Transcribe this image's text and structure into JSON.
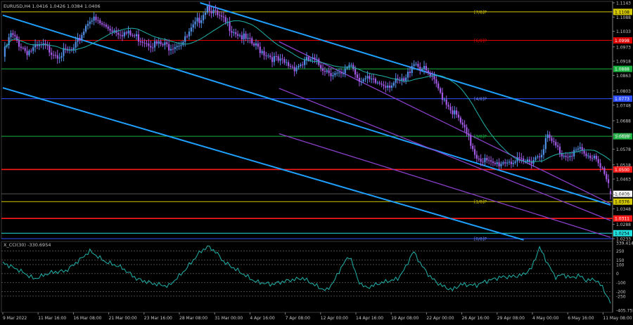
{
  "chart_data": [
    {
      "type": "candlestick",
      "title": "EURUSD,H4  1.0416 1.0426 1.0384 1.0406",
      "symbol": "EURUSD",
      "timeframe": "H4",
      "ohlc": {
        "open": 1.0416,
        "high": 1.0426,
        "low": 1.0384,
        "close": 1.0406
      },
      "ylim": [
        1.0233,
        1.1143
      ],
      "x_tick_labels": [
        "9 Mar 2022",
        "11 Mar 16:00",
        "16 Mar 08:00",
        "21 Mar 00:00",
        "23 Mar 16:00",
        "28 Mar 08:00",
        "31 Mar 00:00",
        "4 Apr 16:00",
        "7 Apr 08:00",
        "12 Apr 00:00",
        "14 Apr 16:00",
        "19 Apr 08:00",
        "22 Apr 00:00",
        "26 Apr 16:00",
        "29 Apr 08:00",
        "4 May 00:00",
        "6 May 16:00",
        "11 May 08:00"
      ],
      "y_tick_labels": [
        "1.1143",
        "1.1088",
        "1.1033",
        "1.0973",
        "1.0918",
        "1.0863",
        "1.0803",
        "1.0748",
        "1.0688",
        "1.0633",
        "1.0578",
        "1.0518",
        "1.0463",
        "1.0403",
        "1.0348",
        "1.0288",
        "1.0233"
      ],
      "close_path": [
        {
          "t": 0,
          "p": 1.0935
        },
        {
          "t": 1,
          "p": 1.102
        },
        {
          "t": 3,
          "p": 1.0955
        },
        {
          "t": 5,
          "p": 1.0975
        },
        {
          "t": 7,
          "p": 1.0945
        },
        {
          "t": 9,
          "p": 1.096
        },
        {
          "t": 11,
          "p": 1.1085
        },
        {
          "t": 13,
          "p": 1.105
        },
        {
          "t": 15,
          "p": 1.103
        },
        {
          "t": 17,
          "p": 1.101
        },
        {
          "t": 19,
          "p": 1.0985
        },
        {
          "t": 21,
          "p": 1.0975
        },
        {
          "t": 23,
          "p": 1.0995
        },
        {
          "t": 25,
          "p": 1.1085
        },
        {
          "t": 26,
          "p": 1.1135
        },
        {
          "t": 27,
          "p": 1.1095
        },
        {
          "t": 29,
          "p": 1.1045
        },
        {
          "t": 31,
          "p": 1.0995
        },
        {
          "t": 33,
          "p": 1.0955
        },
        {
          "t": 35,
          "p": 1.0915
        },
        {
          "t": 37,
          "p": 1.0895
        },
        {
          "t": 39,
          "p": 1.0925
        },
        {
          "t": 41,
          "p": 1.0885
        },
        {
          "t": 43,
          "p": 1.0855
        },
        {
          "t": 44,
          "p": 1.0915
        },
        {
          "t": 45,
          "p": 1.0855
        },
        {
          "t": 47,
          "p": 1.0835
        },
        {
          "t": 49,
          "p": 1.083
        },
        {
          "t": 51,
          "p": 1.084
        },
        {
          "t": 52,
          "p": 1.092
        },
        {
          "t": 54,
          "p": 1.0865
        },
        {
          "t": 56,
          "p": 1.077
        },
        {
          "t": 58,
          "p": 1.068
        },
        {
          "t": 60,
          "p": 1.0555
        },
        {
          "t": 62,
          "p": 1.0515
        },
        {
          "t": 64,
          "p": 1.0535
        },
        {
          "t": 66,
          "p": 1.0525
        },
        {
          "t": 68,
          "p": 1.0555
        },
        {
          "t": 69,
          "p": 1.0625
        },
        {
          "t": 71,
          "p": 1.0555
        },
        {
          "t": 73,
          "p": 1.0575
        },
        {
          "t": 74,
          "p": 1.0545
        },
        {
          "t": 75,
          "p": 1.0555
        },
        {
          "t": 76,
          "p": 1.0505
        },
        {
          "t": 77,
          "p": 1.0406
        }
      ],
      "moving_average_color": "#20b2aa",
      "candle_up_color": "#4f90e6",
      "candle_down_color": "#a259e6",
      "horizontal_levels": [
        {
          "price": 1.1108,
          "label": "[7/8]P",
          "color": "#d4c800",
          "price_label": "1.1108"
        },
        {
          "price": 1.0998,
          "label": "[6/8]P",
          "color": "#e00000",
          "price_label": "1.0998"
        },
        {
          "price": 1.0888,
          "label": "",
          "color": "#1ab040",
          "price_label": "1.0888"
        },
        {
          "price": 1.0773,
          "label": "[4/8]P",
          "color": "#3050ff",
          "price_label": "1.0773"
        },
        {
          "price": 1.0628,
          "label": "[3/8]P",
          "color": "#1ab040",
          "price_label": "1.0628"
        },
        {
          "price": 1.05,
          "label": "",
          "color": "#ff1a1a",
          "price_label": "1.0500"
        },
        {
          "price": 1.0406,
          "label": "",
          "color": "#ffffff",
          "price_label": "1.0406"
        },
        {
          "price": 1.0376,
          "label": "[1/8]P",
          "color": "#d4c800",
          "price_label": "1.0376"
        },
        {
          "price": 1.0311,
          "label": "",
          "color": "#ff1a1a",
          "price_label": "1.0311"
        },
        {
          "price": 1.0254,
          "label": "",
          "color": "#20e0e0",
          "price_label": "1.0254"
        },
        {
          "price": 1.0233,
          "label": "[0/8]P",
          "color": "#3050ff",
          "price_label": ""
        }
      ],
      "trend_channels": [
        {
          "color": "#1fa0ff",
          "t1": 0,
          "p1": 1.1095,
          "t2": 77,
          "p2": 1.0363
        },
        {
          "color": "#1fa0ff",
          "t1": 0,
          "p1": 1.0815,
          "t2": 66,
          "p2": 1.0228
        },
        {
          "color": "#1fa0ff",
          "t1": 25,
          "p1": 1.1143,
          "t2": 77,
          "p2": 1.0658
        },
        {
          "color": "#8a3fc8",
          "t1": 35,
          "p1": 1.0993,
          "t2": 77,
          "p2": 1.0368
        },
        {
          "color": "#8a3fc8",
          "t1": 35,
          "p1": 1.0638,
          "t2": 77,
          "p2": 1.0238
        },
        {
          "color": "#8a3fc8",
          "t1": 35,
          "p1": 1.0813,
          "t2": 77,
          "p2": 1.0303
        }
      ]
    },
    {
      "type": "line",
      "title": "X_CCI(30) -330.6954",
      "indicator": "CCI",
      "period": 30,
      "last_value": -330.6954,
      "line_color": "#20b2aa",
      "ylim": [
        -405.7559,
        339.4148
      ],
      "y_tick_labels": [
        "339.4148",
        "250",
        "150",
        "100",
        "0",
        "-100",
        "-200",
        "-250",
        "-405.7559"
      ],
      "levels": [
        250,
        150,
        100,
        0,
        -100,
        -200,
        -250
      ],
      "values": [
        {
          "t": 0,
          "v": 120
        },
        {
          "t": 2,
          "v": 40
        },
        {
          "t": 4,
          "v": -60
        },
        {
          "t": 6,
          "v": 10
        },
        {
          "t": 8,
          "v": 30
        },
        {
          "t": 10,
          "v": 170
        },
        {
          "t": 11,
          "v": 250
        },
        {
          "t": 13,
          "v": 130
        },
        {
          "t": 15,
          "v": 70
        },
        {
          "t": 17,
          "v": -60
        },
        {
          "t": 19,
          "v": -110
        },
        {
          "t": 21,
          "v": -140
        },
        {
          "t": 23,
          "v": 30
        },
        {
          "t": 25,
          "v": 240
        },
        {
          "t": 26,
          "v": 300
        },
        {
          "t": 27,
          "v": 240
        },
        {
          "t": 28,
          "v": 130
        },
        {
          "t": 30,
          "v": 20
        },
        {
          "t": 32,
          "v": -90
        },
        {
          "t": 34,
          "v": -120
        },
        {
          "t": 36,
          "v": -80
        },
        {
          "t": 38,
          "v": -50
        },
        {
          "t": 40,
          "v": -150
        },
        {
          "t": 41,
          "v": -190
        },
        {
          "t": 42,
          "v": -80
        },
        {
          "t": 43,
          "v": 90
        },
        {
          "t": 44,
          "v": 200
        },
        {
          "t": 45,
          "v": -80
        },
        {
          "t": 46,
          "v": -160
        },
        {
          "t": 48,
          "v": -100
        },
        {
          "t": 50,
          "v": -60
        },
        {
          "t": 51,
          "v": 60
        },
        {
          "t": 52,
          "v": 250
        },
        {
          "t": 53,
          "v": 100
        },
        {
          "t": 54,
          "v": -20
        },
        {
          "t": 55,
          "v": -100
        },
        {
          "t": 56,
          "v": -150
        },
        {
          "t": 57,
          "v": -180
        },
        {
          "t": 58,
          "v": -120
        },
        {
          "t": 60,
          "v": -130
        },
        {
          "t": 61,
          "v": -90
        },
        {
          "t": 63,
          "v": -40
        },
        {
          "t": 65,
          "v": -30
        },
        {
          "t": 66,
          "v": -10
        },
        {
          "t": 67,
          "v": 60
        },
        {
          "t": 68,
          "v": 290
        },
        {
          "t": 69,
          "v": 120
        },
        {
          "t": 70,
          "v": -40
        },
        {
          "t": 71,
          "v": -10
        },
        {
          "t": 72,
          "v": -50
        },
        {
          "t": 73,
          "v": -20
        },
        {
          "t": 74,
          "v": -80
        },
        {
          "t": 75,
          "v": -60
        },
        {
          "t": 76,
          "v": -150
        },
        {
          "t": 77,
          "v": -330.6954
        }
      ]
    }
  ]
}
